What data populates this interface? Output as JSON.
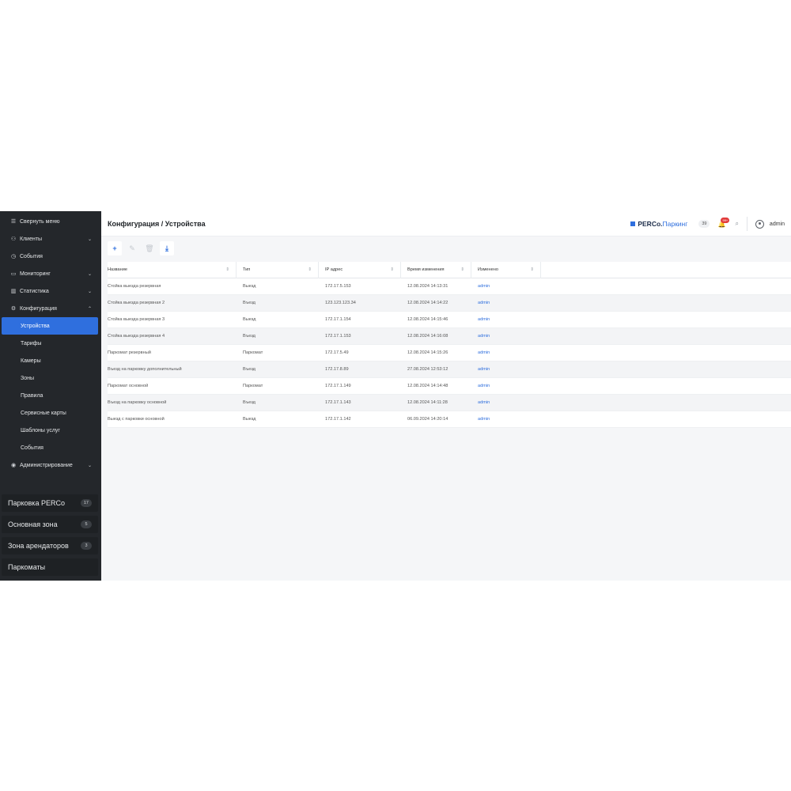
{
  "sidebar": {
    "items": [
      {
        "icon": "menu-icon",
        "glyph": "☰",
        "label": "Свернуть меню"
      },
      {
        "icon": "users-icon",
        "glyph": "⚇",
        "label": "Клиенты",
        "chevron": "⌄"
      },
      {
        "icon": "history-icon",
        "glyph": "◷",
        "label": "События"
      },
      {
        "icon": "monitor-icon",
        "glyph": "▭",
        "label": "Мониторинг",
        "chevron": "⌄"
      },
      {
        "icon": "chart-icon",
        "glyph": "▥",
        "label": "Статистика",
        "chevron": "⌄"
      },
      {
        "icon": "gear-icon",
        "glyph": "⚙",
        "label": "Конфигурация",
        "chevron": "⌃"
      }
    ],
    "config_sub": [
      "Устройства",
      "Тарифы",
      "Камеры",
      "Зоны",
      "Правила",
      "Сервисные карты",
      "Шаблоны услуг",
      "События"
    ],
    "admin": {
      "icon": "shield-icon",
      "glyph": "◉",
      "label": "Администрирование",
      "chevron": "⌄"
    },
    "zones": [
      {
        "label": "Парковка PERCo",
        "count": "17"
      },
      {
        "label": "Основная зона",
        "count": "5"
      },
      {
        "label": "Зона арендаторов",
        "count": "3"
      },
      {
        "label": "Паркоматы",
        "count": ""
      }
    ]
  },
  "header": {
    "breadcrumb": "Конфигурация / Устройства",
    "logo_part1": "PERCo.",
    "logo_part2": "Паркинг",
    "counter": "39",
    "notifications": "99+",
    "user": "admin"
  },
  "toolbar": {
    "add": "+",
    "edit": "✎",
    "delete": "🗑",
    "export": "⤓"
  },
  "table": {
    "columns": [
      "Название",
      "Тип",
      "IP адрес",
      "Время изменения",
      "Изменено"
    ],
    "sort_glyph": "⇕",
    "rows": [
      [
        "Стойка выезда резервная",
        "Выезд",
        "172.17.5.153",
        "12.08.2024 14:13:31",
        "admin"
      ],
      [
        "Стойка выезда резервная 2",
        "Въезд",
        "123.123.123.34",
        "12.08.2024 14:14:22",
        "admin"
      ],
      [
        "Стойка выезда резервная 3",
        "Выезд",
        "172.17.1.154",
        "12.08.2024 14:15:46",
        "admin"
      ],
      [
        "Стойка выезда резервная 4",
        "Въезд",
        "172.17.1.153",
        "12.08.2024 14:16:08",
        "admin"
      ],
      [
        "Паркомат резервный",
        "Паркомат",
        "172.17.5.49",
        "12.08.2024 14:15:26",
        "admin"
      ],
      [
        "Въезд на парковку дополнительный",
        "Въезд",
        "172.17.8.89",
        "27.08.2024 12:53:12",
        "admin"
      ],
      [
        "Паркомат основной",
        "Паркомат",
        "172.17.1.149",
        "12.08.2024 14:14:48",
        "admin"
      ],
      [
        "Въезд на парковку основной",
        "Въезд",
        "172.17.1.143",
        "12.08.2024 14:11:28",
        "admin"
      ],
      [
        "Выезд с парковки основной",
        "Выезд",
        "172.17.1.142",
        "06.09.2024 14:20:14",
        "admin"
      ]
    ]
  }
}
